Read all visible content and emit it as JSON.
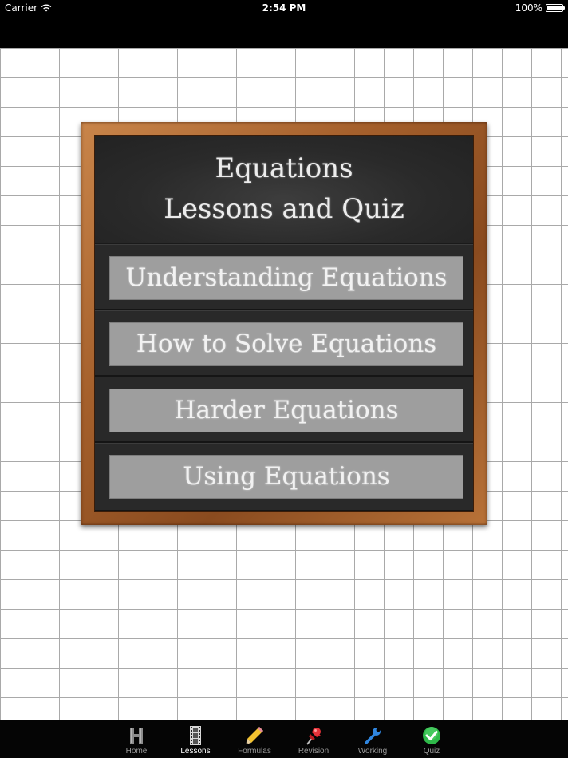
{
  "status_bar": {
    "carrier": "Carrier",
    "time": "2:54 PM",
    "battery": "100%"
  },
  "board": {
    "title_line1": "Equations",
    "title_line2": "Lessons and Quiz",
    "lessons": [
      {
        "label": "Understanding Equations"
      },
      {
        "label": "How to Solve Equations"
      },
      {
        "label": "Harder Equations"
      },
      {
        "label": "Using Equations"
      }
    ]
  },
  "tab_bar": {
    "tabs": [
      {
        "label": "Home",
        "icon": "home-h-icon"
      },
      {
        "label": "Lessons",
        "icon": "film-strip-icon",
        "active": true
      },
      {
        "label": "Formulas",
        "icon": "pencil-icon"
      },
      {
        "label": "Revision",
        "icon": "pushpin-icon"
      },
      {
        "label": "Working",
        "icon": "wrench-icon"
      },
      {
        "label": "Quiz",
        "icon": "checkmark-icon"
      }
    ]
  },
  "colors": {
    "chalkboard": "#262626",
    "frame_wood": "#a5602c",
    "button_gray": "#9e9e9e",
    "tab_active": "#ffffff",
    "tab_inactive": "#9a9a9a"
  }
}
